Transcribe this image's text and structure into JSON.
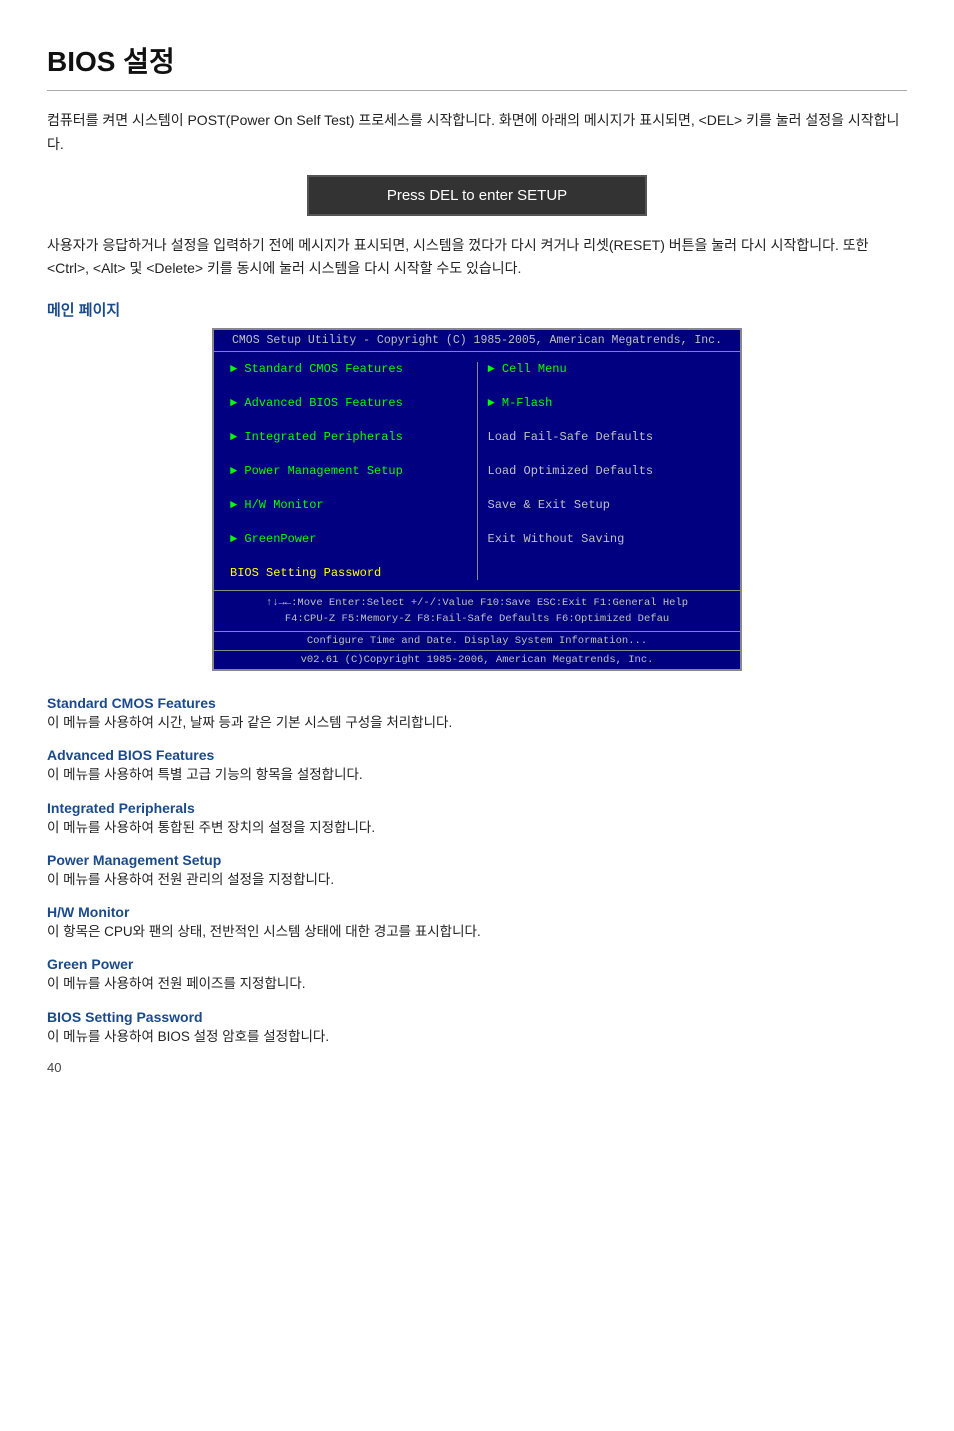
{
  "page": {
    "title": "BIOS 설정",
    "page_number": "40"
  },
  "intro": {
    "paragraph1": "컴퓨터를 켜면 시스템이 POST(Power On Self Test) 프로세스를 시작합니다. 화면에 아래의 메시지가 표시되면, <DEL> 키를 눌러 설정을 시작합니다.",
    "del_box": "Press DEL to enter SETUP",
    "paragraph2": "사용자가 응답하거나 설정을 입력하기 전에 메시지가 표시되면, 시스템을 껐다가 다시 켜거나 리셋(RESET) 버튼을 눌러 다시 시작합니다. 또한 <Ctrl>, <Alt> 및 <Delete> 키를 동시에 눌러 시스템을 다시 시작할 수도 있습니다."
  },
  "main_page": {
    "label": "메인 페이지",
    "bios_title": "CMOS Setup Utility - Copyright (C) 1985-2005, American Megatrends, Inc.",
    "left_menu": [
      {
        "label": "Standard CMOS Features",
        "type": "arrow"
      },
      {
        "label": "Advanced BIOS Features",
        "type": "arrow"
      },
      {
        "label": "Integrated Peripherals",
        "type": "arrow"
      },
      {
        "label": "Power Management Setup",
        "type": "arrow"
      },
      {
        "label": "H/W Monitor",
        "type": "arrow"
      },
      {
        "label": "GreenPower",
        "type": "arrow"
      },
      {
        "label": "BIOS Setting Password",
        "type": "plain-yellow"
      }
    ],
    "right_menu": [
      {
        "label": "Cell Menu",
        "type": "arrow"
      },
      {
        "label": "M-Flash",
        "type": "arrow"
      },
      {
        "label": "Load Fail-Safe Defaults",
        "type": "plain"
      },
      {
        "label": "Load Optimized Defaults",
        "type": "plain"
      },
      {
        "label": "Save & Exit Setup",
        "type": "plain"
      },
      {
        "label": "Exit Without Saving",
        "type": "plain"
      }
    ],
    "footer1": "↑↓→←:Move  Enter:Select  +/-/:Value  F10:Save  ESC:Exit  F1:General Help",
    "footer2": "F4:CPU-Z    F5:Memory-Z    F8:Fail-Safe Defaults    F6:Optimized Defau",
    "status1": "Configure Time and Date.  Display System Information...",
    "status2": "v02.61 (C)Copyright 1985-2006, American Megatrends, Inc."
  },
  "sections": [
    {
      "title": "Standard CMOS Features",
      "desc": "이 메뉴를 사용하여 시간, 날짜 등과 같은 기본 시스템 구성을 처리합니다."
    },
    {
      "title": "Advanced BIOS Features",
      "desc": "이 메뉴를 사용하여 특별 고급 기능의 항목을 설정합니다."
    },
    {
      "title": "Integrated Peripherals",
      "desc": "이 메뉴를 사용하여 통합된 주변 장치의 설정을 지정합니다."
    },
    {
      "title": "Power Management Setup",
      "desc": "이 메뉴를 사용하여 전원 관리의 설정을 지정합니다."
    },
    {
      "title": "H/W Monitor",
      "desc": "이 항목은 CPU와 팬의 상태, 전반적인 시스템 상태에 대한 경고를 표시합니다."
    },
    {
      "title": "Green Power",
      "desc": "이 메뉴를 사용하여 전원 페이즈를 지정합니다."
    },
    {
      "title": "BIOS Setting Password",
      "desc": "이 메뉴를 사용하여 BIOS 설정 암호를 설정합니다."
    }
  ]
}
